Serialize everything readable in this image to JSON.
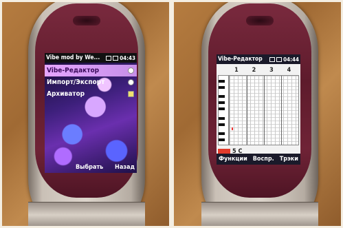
{
  "left_phone": {
    "status": {
      "title": "Vibe mod by We...",
      "time": "04:43"
    },
    "menu": [
      {
        "label": "Vibe-Редактор",
        "selected": true
      },
      {
        "label": "Импорт/Экспорт",
        "selected": false
      },
      {
        "label": "Архиватор",
        "selected": false
      }
    ],
    "softkeys": {
      "left": "Выбрать",
      "right": "Назад"
    }
  },
  "right_phone": {
    "status": {
      "title": "Vibe-Редактор",
      "time": "04:44"
    },
    "bar_numbers": [
      "1",
      "2",
      "3",
      "4"
    ],
    "status_text": "5 C",
    "softkeys": {
      "left": "Функции",
      "middle": "Воспр.",
      "right": "Трэки"
    }
  },
  "colors": {
    "menu_selected": "#e6a6ff",
    "volume_bar": "#e23b2b",
    "phone_lid": "#6f2336"
  }
}
